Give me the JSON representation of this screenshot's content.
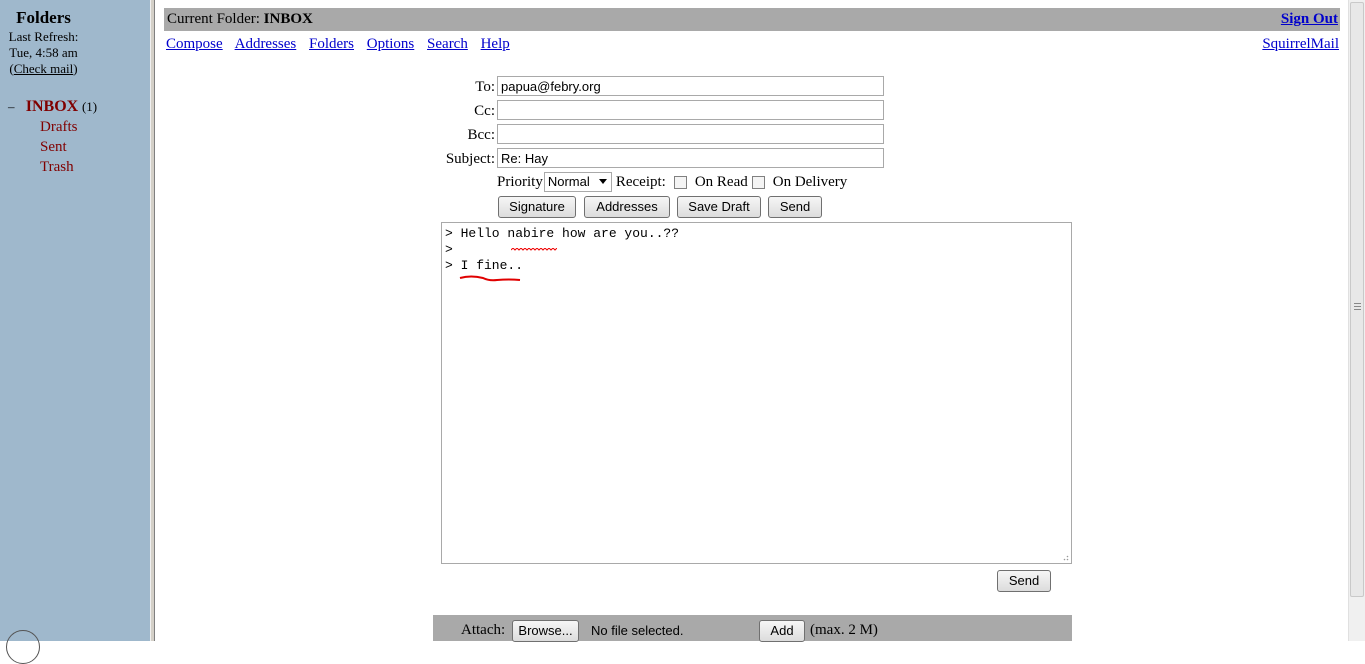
{
  "sidebar": {
    "title": "Folders",
    "last_refresh_label": "Last Refresh:",
    "last_refresh_time": "Tue, 4:58 am",
    "check_mail_open": "(",
    "check_mail": "Check mail",
    "check_mail_close": ")",
    "inbox": {
      "toggle": "–",
      "label": "INBOX",
      "count": "(1)"
    },
    "subfolders": [
      "Drafts",
      "Sent",
      "Trash"
    ]
  },
  "header": {
    "current_folder_label": "Current Folder: ",
    "current_folder": "INBOX",
    "sign_out": "Sign Out"
  },
  "nav": {
    "items": [
      "Compose",
      "Addresses",
      "Folders",
      "Options",
      "Search",
      "Help"
    ],
    "brand": "SquirrelMail"
  },
  "compose": {
    "to_label": "To:",
    "to_value": "papua@febry.org",
    "cc_label": "Cc:",
    "cc_value": "",
    "bcc_label": "Bcc:",
    "bcc_value": "",
    "subject_label": "Subject:",
    "subject_value": "Re: Hay",
    "priority_label": "Priority",
    "priority_value": "Normal",
    "receipt_label": "Receipt:",
    "on_read": "On Read",
    "on_delivery": "On Delivery",
    "buttons": {
      "signature": "Signature",
      "addresses": "Addresses",
      "save_draft": "Save Draft",
      "send": "Send"
    },
    "body_lines": [
      "> Hello nabire how are you..??",
      ">",
      "> I fine.."
    ],
    "send_bottom": "Send"
  },
  "attach": {
    "label": "Attach:",
    "browse": "Browse...",
    "no_file": "No file selected.",
    "add": "Add",
    "max": "(max. 2 M)"
  }
}
